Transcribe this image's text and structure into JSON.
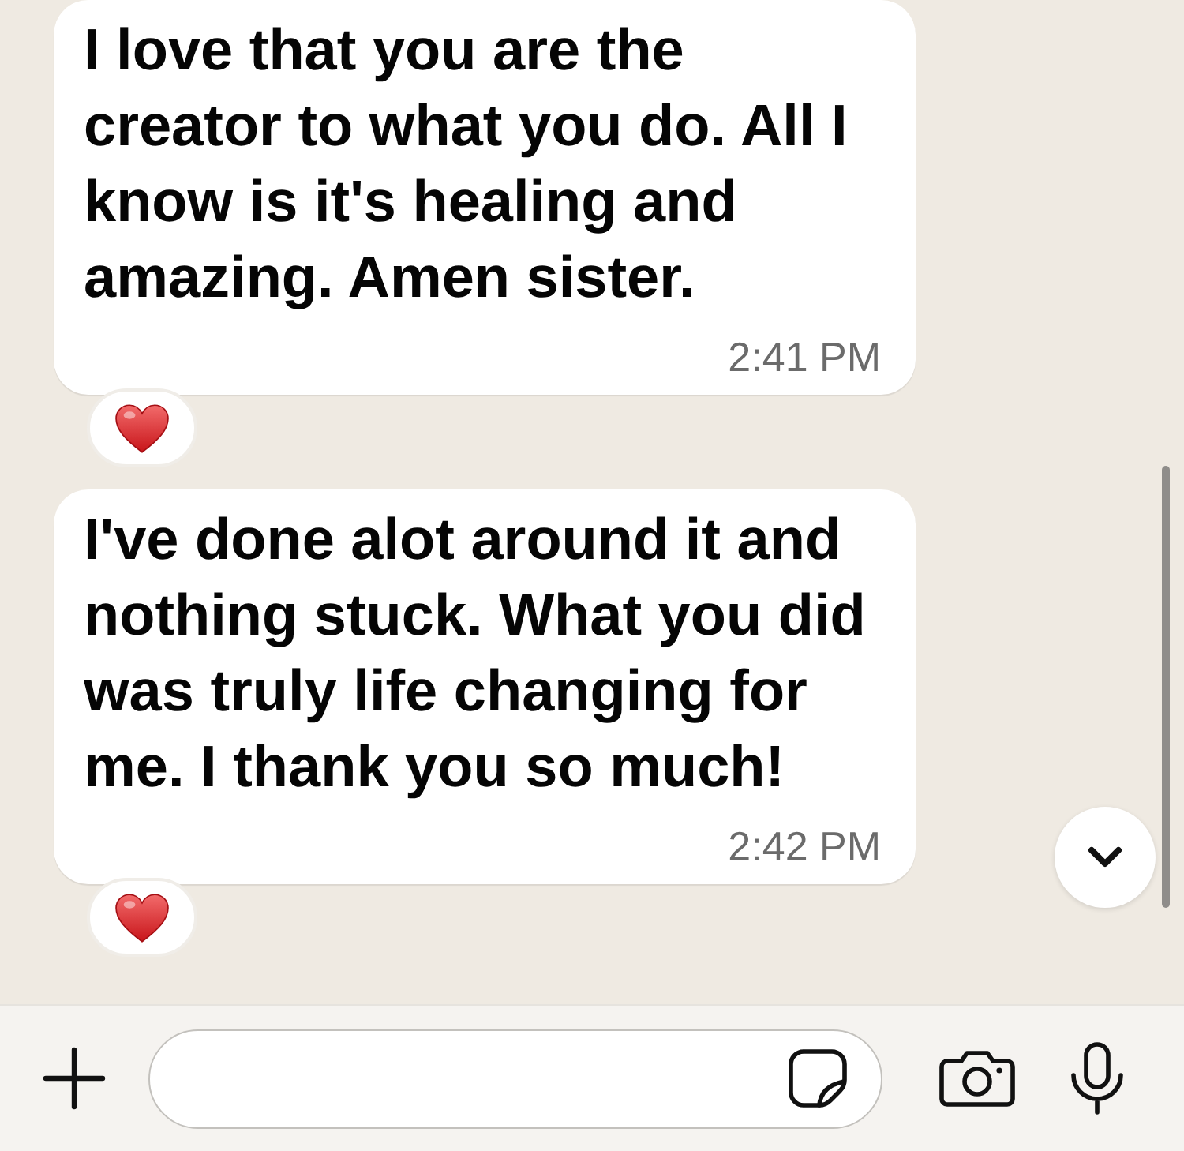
{
  "messages": [
    {
      "text": "I love that you are the creator to what you do. All I know is it's healing and amazing. Amen sister.",
      "time": "2:41 PM",
      "reacted": true
    },
    {
      "text": "I've done alot around it and nothing stuck. What you did was truly life changing for me. I thank you so much!",
      "time": "2:42 PM",
      "reacted": true
    }
  ]
}
